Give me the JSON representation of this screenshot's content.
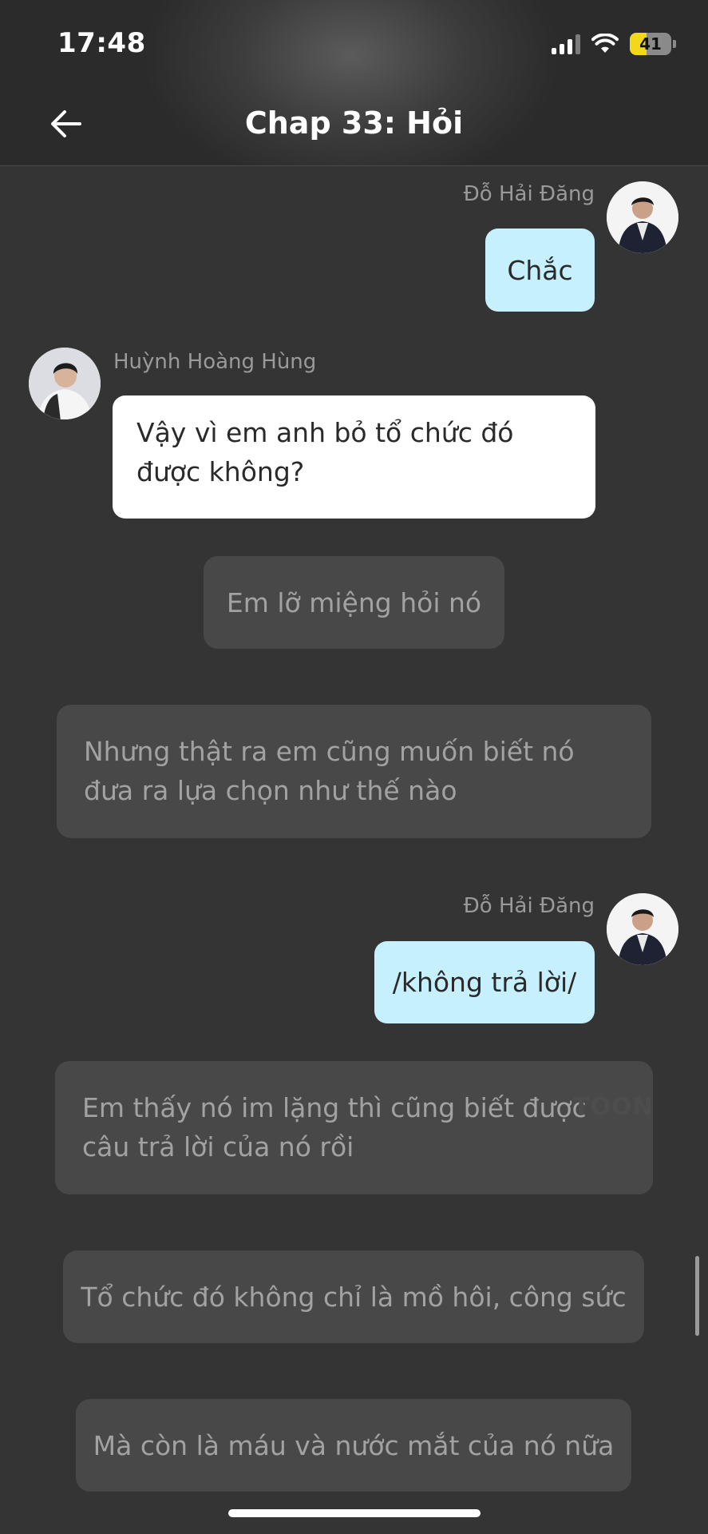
{
  "status_bar": {
    "time": "17:48",
    "battery_level": "41",
    "battery_fraction": 0.41,
    "signal_bars_active": 3,
    "signal_bars_total": 4
  },
  "header": {
    "title": "Chap 33: Hỏi",
    "back_icon": "arrow-left-icon"
  },
  "messages": {
    "m1_sender": "Đỗ Hải Đăng",
    "m1_text": "Chắc",
    "m2_sender": "Huỳnh Hoàng Hùng",
    "m2_text": "Vậy vì em anh bỏ tổ chức đó được không?",
    "n1": "Em lỡ miệng hỏi nó",
    "n2": "Nhưng thật ra em cũng muốn biết nó đưa ra lựa chọn như thế nào",
    "m3_sender": "Đỗ Hải Đăng",
    "m3_text": "/không trả lời/",
    "n3": "Em thấy nó im lặng thì cũng biết được câu trả lời của nó rồi",
    "n4": "Tổ chức đó không chỉ là mồ hôi, công sức",
    "n5": "Mà còn là máu và nước mắt của nó nữa"
  },
  "watermark": "TOON",
  "colors": {
    "background": "#343434",
    "own_bubble": "#c6f0fe",
    "other_bubble": "#ffffff",
    "narration_box": "#484848",
    "battery": "#f3d71b"
  }
}
